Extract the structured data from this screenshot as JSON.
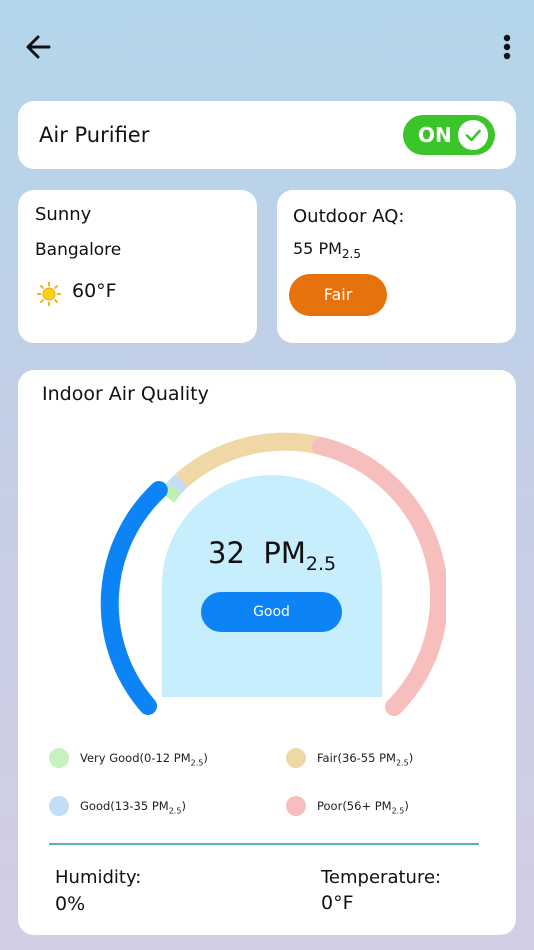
{
  "topbar": {
    "back_icon": "arrow-left-icon",
    "menu_icon": "more-vertical-icon"
  },
  "purifier": {
    "title": "Air Purifier",
    "toggle_label": "ON",
    "toggle_on": true,
    "toggle_color": "#3bc52b"
  },
  "weather": {
    "condition": "Sunny",
    "city": "Bangalore",
    "icon": "sun-icon",
    "temperature": "60°F"
  },
  "outdoor": {
    "title": "Outdoor AQ:",
    "value": "55 PM",
    "unit_sub": "2.5",
    "status": "Fair",
    "status_color": "#e5720d"
  },
  "indoor": {
    "title": "Indoor Air Quality",
    "value": "32",
    "unit": "PM",
    "unit_sub": "2.5",
    "status": "Good",
    "status_color": "#0c84f5",
    "gauge_colors": {
      "very_good": "#bdf0b4",
      "good": "#c4ddf7",
      "fair": "#f0d8a6",
      "poor": "#f6bfbe",
      "fill": "#c6eefc",
      "active": "#0c84f5"
    }
  },
  "legend": [
    {
      "label": "Very Good(0-12  PM",
      "sub": "2.5",
      "suffix": ")",
      "color": "#c7f1bd"
    },
    {
      "label": "Fair(36-55  PM",
      "sub": "2.5",
      "suffix": ")",
      "color": "#f0d8a6"
    },
    {
      "label": "Good(13-35  PM",
      "sub": "2.5",
      "suffix": ")",
      "color": "#c4ddf7"
    },
    {
      "label": "Poor(56+  PM",
      "sub": "2.5",
      "suffix": ")",
      "color": "#f6bfbe"
    }
  ],
  "stats": {
    "humidity_label": "Humidity:",
    "humidity_value": "0%",
    "temperature_label": "Temperature:",
    "temperature_value": "0°F"
  }
}
